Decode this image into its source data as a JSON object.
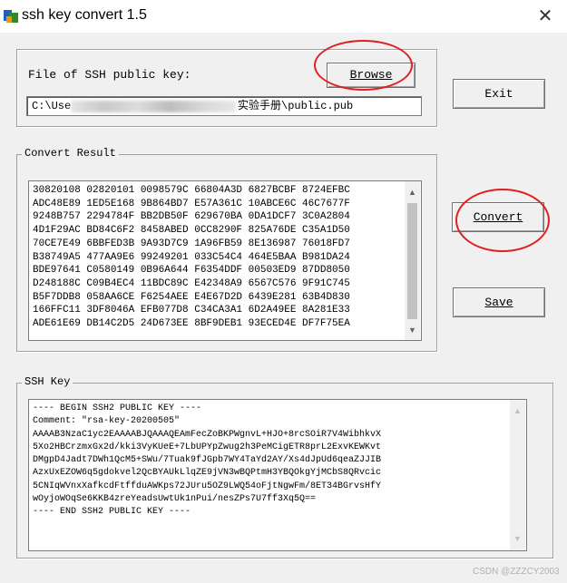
{
  "window": {
    "title": "ssh key convert 1.5",
    "close_glyph": "✕"
  },
  "file_group": {
    "label": "File of SSH public key:",
    "browse_button": "Browse",
    "path_prefix": "C:\\Use",
    "path_suffix": "实验手册\\public.pub"
  },
  "buttons": {
    "exit": "Exit",
    "convert": "Convert",
    "save": "Save"
  },
  "convert_result": {
    "label": "Convert Result",
    "lines": [
      "30820108 02820101 0098579C 66804A3D 6827BCBF 8724EFBC",
      "ADC48E89 1ED5E168 9B864BD7 E57A361C 10ABCE6C 46C7677F",
      "9248B757 2294784F BB2DB50F 629670BA 0DA1DCF7 3C0A2804",
      "4D1F29AC BD84C6F2 8458ABED 0CC8290F 825A76DE C35A1D50",
      "70CE7E49 6BBFED3B 9A93D7C9 1A96FB59 8E136987 76018FD7",
      "B38749A5 477AA9E6 99249201 033C54C4 464E5BAA B981DA24",
      "BDE97641 C0580149 0B96A644 F6354DDF 00503ED9 87DD8050",
      "D248188C C09B4EC4 11BDC89C E42348A9 6567C576 9F91C745",
      "B5F7DDB8 058AA6CE F6254AEE E4E67D2D 6439E281 63B4D830",
      "166FFC11 3DF8046A EFB077D8 C34CA3A1 6D2A49EE 8A281E33",
      "ADE61E69 DB14C2D5 24D673EE 8BF9DEB1 93ECED4E DF7F75EA"
    ]
  },
  "ssh_key": {
    "label": "SSH Key",
    "lines": [
      "---- BEGIN SSH2 PUBLIC KEY ----",
      "Comment: \"rsa-key-20200505\"",
      "AAAAB3NzaC1yc2EAAAABJQAAAQEAmFecZoBKPWgnvL+HJO+8rcSOiR7V4WibhkvX",
      "5Xo2HBCrzmxGx2d/kki3VyKUeE+7LbUPYpZwug2h3PeMCigETR8prL2ExvKEWKvt",
      "DMgpD4Jadt7DWh1QcM5+SWu/7Tuak9fJGpb7WY4TaYd2AY/Xs4dJpUd6qeaZJJIB",
      "AzxUxEZOW6q5gdokvel2QcBYAUkLlqZE9jVN3wBQPtmH3YBQOkgYjMCbS8QRvcic",
      "5CNIqWVnxXafkcdFtffduAWKps72JUru5OZ9LWQ54oFjtNgwFm/8ET34BGrvsHfY",
      "wOyjoWOqSe6KKB4zreYeadsUwtUk1nPui/nesZPs7U7ff3Xq5Q==",
      "---- END SSH2 PUBLIC KEY ----"
    ]
  },
  "watermark": "CSDN @ZZZCY2003",
  "colors": {
    "annotation_red": "#e02020",
    "window_bg": "#f0f0f0"
  }
}
